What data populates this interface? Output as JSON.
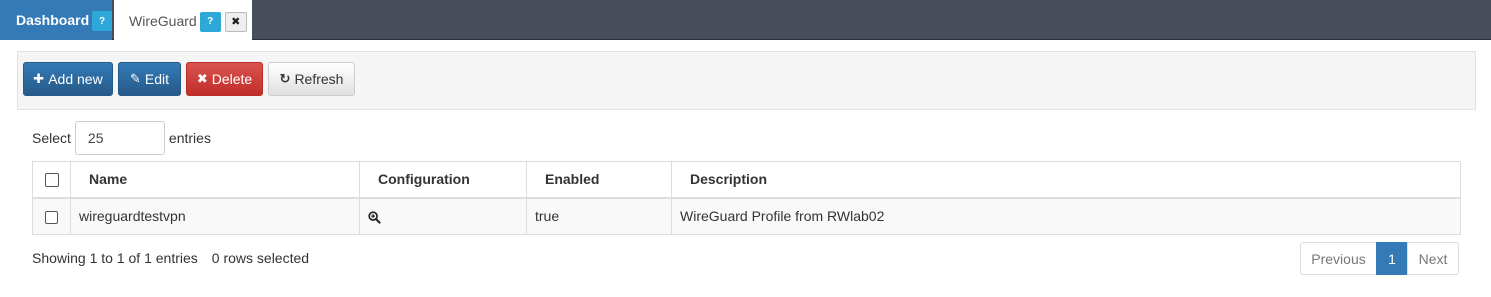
{
  "tabs": [
    {
      "label": "Dashboard",
      "help": "?"
    },
    {
      "label": "WireGuard",
      "help": "?",
      "close": "✖"
    }
  ],
  "toolbar": {
    "add_label": "Add new",
    "edit_label": "Edit",
    "delete_label": "Delete",
    "refresh_label": "Refresh"
  },
  "page_size": {
    "prefix": "Select",
    "value": "25",
    "suffix": "entries"
  },
  "table": {
    "columns": [
      "Name",
      "Configuration",
      "Enabled",
      "Description"
    ],
    "rows": [
      {
        "name": "wireguardtestvpn",
        "configuration_icon": "zoom-icon",
        "enabled": "true",
        "description": "WireGuard Profile from RWlab02"
      }
    ]
  },
  "footer": {
    "info": "Showing 1 to 1 of 1 entries",
    "selected": "0 rows selected"
  },
  "pagination": {
    "previous": "Previous",
    "current": "1",
    "next": "Next"
  },
  "colors": {
    "primary": "#337ab7",
    "danger": "#d9534f",
    "tabbar": "#474e5a",
    "help": "#2ea8d8"
  }
}
